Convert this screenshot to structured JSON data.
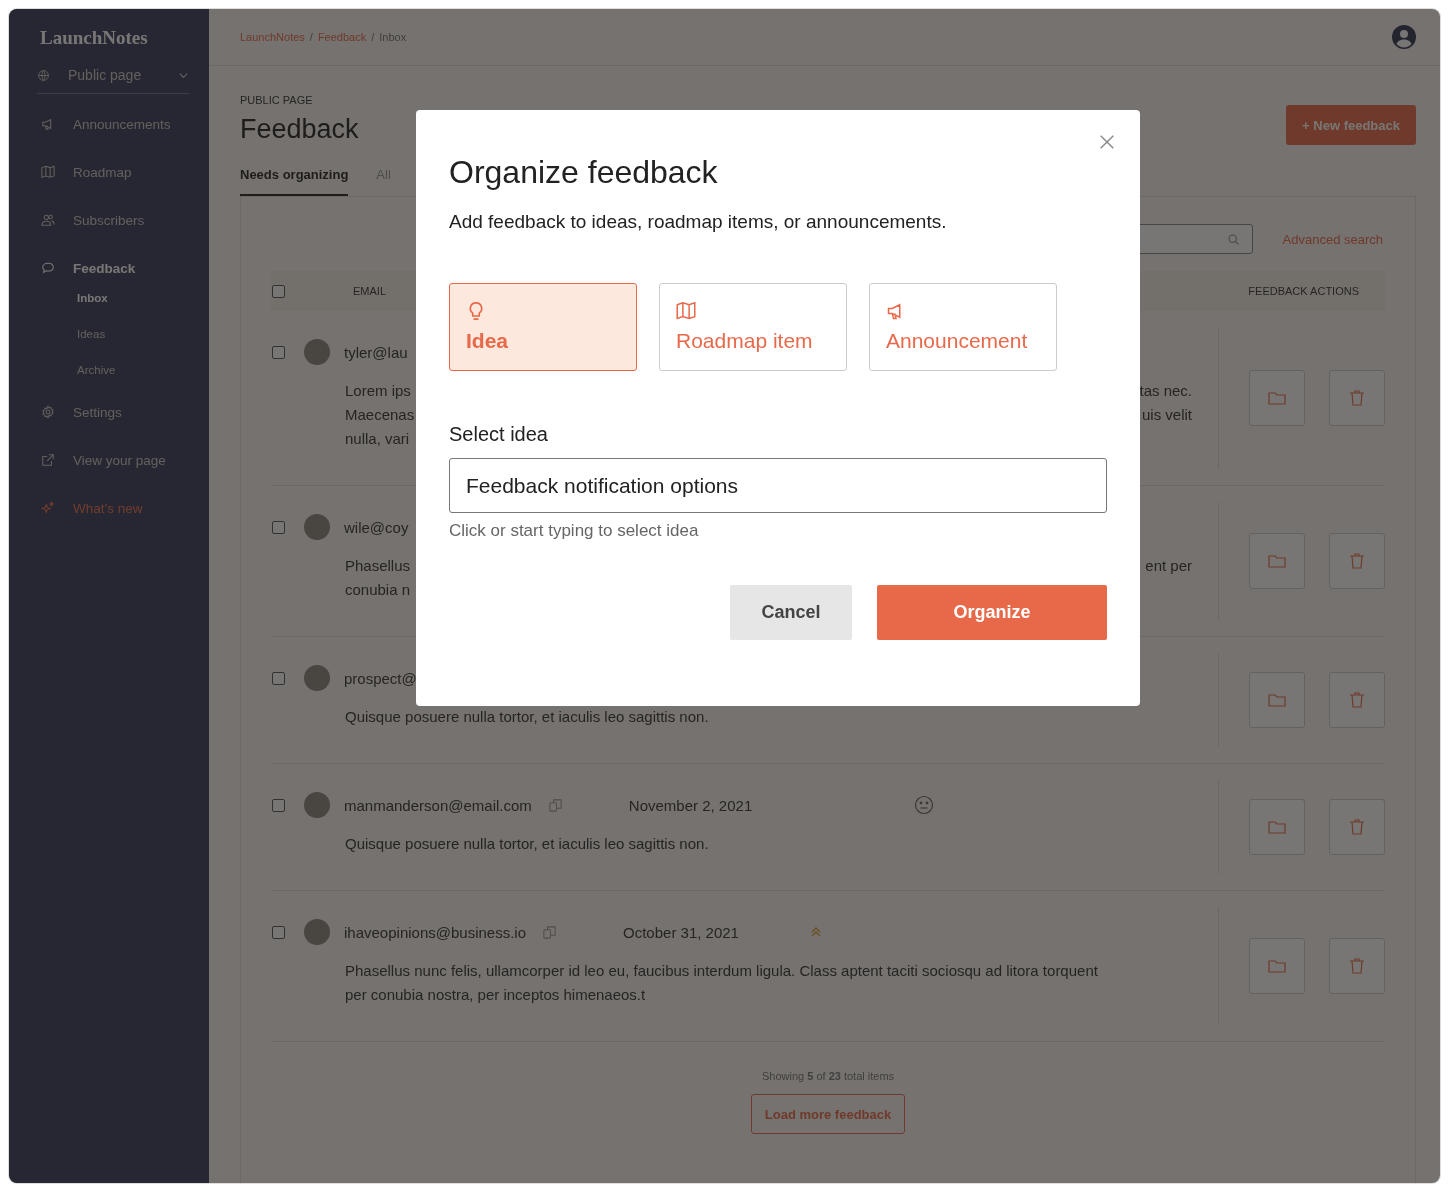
{
  "sidebar": {
    "logo": "LaunchNotes",
    "page_selector": {
      "label": "Public page",
      "expanded": false
    },
    "items": [
      {
        "label": "Announcements",
        "kind": "nav",
        "selected": false
      },
      {
        "label": "Roadmap",
        "kind": "nav",
        "selected": false
      },
      {
        "label": "Subscribers",
        "kind": "nav",
        "selected": false
      },
      {
        "label": "Feedback",
        "kind": "nav",
        "selected": true,
        "children": [
          {
            "label": "Inbox",
            "selected": true
          },
          {
            "label": "Ideas",
            "selected": false
          },
          {
            "label": "Archive",
            "selected": false
          }
        ]
      },
      {
        "label": "Settings",
        "kind": "nav",
        "selected": false
      },
      {
        "label": "View your page",
        "kind": "nav",
        "selected": false
      },
      {
        "label": "What’s new",
        "kind": "promo",
        "selected": false
      }
    ]
  },
  "breadcrumb": [
    {
      "label": "LaunchNotes",
      "kind": "link"
    },
    {
      "label": "/",
      "kind": "separator"
    },
    {
      "label": "Feedback",
      "kind": "link"
    },
    {
      "label": "/",
      "kind": "separator"
    },
    {
      "label": "Inbox",
      "kind": "current"
    }
  ],
  "header": {
    "eyebrow": "PUBLIC PAGE",
    "title": "Feedback",
    "new_button": "+ New feedback"
  },
  "tabs": [
    {
      "label": "Needs organizing",
      "selected": true
    },
    {
      "label": "All",
      "selected": false
    }
  ],
  "toolbar": {
    "advanced_search": "Advanced search"
  },
  "table": {
    "columns": [
      "EMAIL",
      "FEEDBACK ACTIONS"
    ],
    "header_checked": false,
    "rows": [
      {
        "checked": false,
        "kind": "plain",
        "email": "tyler@lau",
        "lines": [
          {
            "left": "Lorem ips",
            "right": "tas nec."
          },
          {
            "left": "Maecenas",
            "right": "uis velit"
          },
          {
            "left": "nulla, vari"
          }
        ]
      },
      {
        "checked": false,
        "kind": "plain",
        "email": "wile@coy",
        "lines": [
          {
            "left": "Phasellus",
            "right": "ent per"
          },
          {
            "left": "conubia n"
          }
        ]
      },
      {
        "checked": false,
        "kind": "plain",
        "email": "prospect@",
        "lines": [
          {
            "left": "Quisque posuere nulla tortor, et iaculis leo sagittis non."
          }
        ]
      },
      {
        "checked": false,
        "kind": "neutral",
        "email": "manmanderson@email.com",
        "date": "November 2, 2021",
        "lines": [
          {
            "left": "Quisque posuere nulla tortor, et iaculis leo sagittis non."
          }
        ]
      },
      {
        "checked": false,
        "kind": "priority",
        "email": "ihaveopinions@business.io",
        "date": "October 31, 2021",
        "lines": [
          {
            "left": "Phasellus nunc felis, ullamcorper id leo eu, faucibus interdum ligula. Class aptent taciti sociosqu ad litora torquent"
          },
          {
            "left": "per conubia nostra, per inceptos himenaeos.t"
          }
        ]
      }
    ]
  },
  "footer": {
    "summary": "Showing **5** of **23** total items",
    "load_more": "Load more feedback"
  },
  "modal": {
    "title": "Organize feedback",
    "subtitle": "Add feedback to ideas, roadmap items, or announcements.",
    "options": [
      {
        "label": "Idea",
        "selected": true
      },
      {
        "label": "Roadmap item",
        "selected": false
      },
      {
        "label": "Announcement",
        "selected": false
      }
    ],
    "field_label": "Select idea",
    "field_value": "Feedback notification options",
    "hint": "Click or start typing to select idea",
    "buttons": [
      {
        "label": "Cancel",
        "kind": "secondary"
      },
      {
        "label": "Organize",
        "kind": "primary"
      }
    ]
  }
}
